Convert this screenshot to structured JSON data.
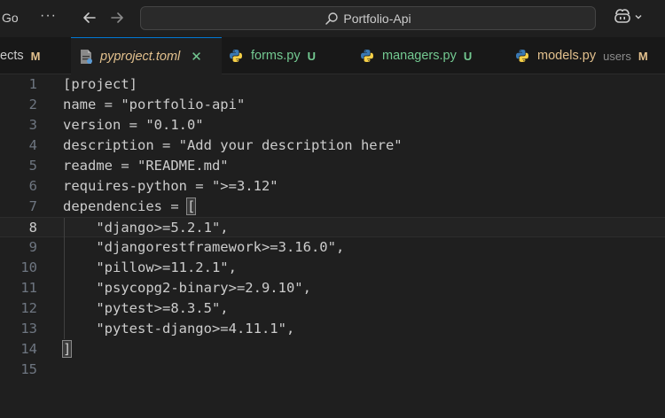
{
  "titlebar": {
    "menu_go": "Go",
    "menu_more": "···",
    "search_text": "Portfolio-Api",
    "icons": [
      "arrow-left-icon",
      "arrow-right-icon",
      "search-icon",
      "copilot-icon",
      "chevron-down-icon"
    ]
  },
  "tabs": [
    {
      "label": "ects",
      "status": "M",
      "kind": "partial"
    },
    {
      "label": "pyproject.toml",
      "status": "",
      "kind": "active",
      "close": "✕"
    },
    {
      "label": "forms.py",
      "status": "U",
      "kind": "python"
    },
    {
      "label": "managers.py",
      "status": "U",
      "kind": "python"
    },
    {
      "label": "models.py",
      "dir": "users",
      "status": "M",
      "kind": "python"
    }
  ],
  "editor": {
    "current_line": 8,
    "lines": [
      {
        "n": "1",
        "text": "[project]"
      },
      {
        "n": "2",
        "text": "name = \"portfolio-api\""
      },
      {
        "n": "3",
        "text": "version = \"0.1.0\""
      },
      {
        "n": "4",
        "text": "description = \"Add your description here\""
      },
      {
        "n": "5",
        "text": "readme = \"README.md\""
      },
      {
        "n": "6",
        "text": "requires-python = \">=3.12\""
      },
      {
        "n": "7",
        "text": "dependencies = ",
        "bracket": "["
      },
      {
        "n": "8",
        "text": "    \"django>=5.2.1\","
      },
      {
        "n": "9",
        "text": "    \"djangorestframework>=3.16.0\","
      },
      {
        "n": "10",
        "text": "    \"pillow>=11.2.1\","
      },
      {
        "n": "11",
        "text": "    \"psycopg2-binary>=2.9.10\","
      },
      {
        "n": "12",
        "text": "    \"pytest>=8.3.5\","
      },
      {
        "n": "13",
        "text": "    \"pytest-django>=4.11.1\","
      },
      {
        "n": "14",
        "text": "",
        "bracket": "]"
      },
      {
        "n": "15",
        "text": ""
      }
    ]
  }
}
